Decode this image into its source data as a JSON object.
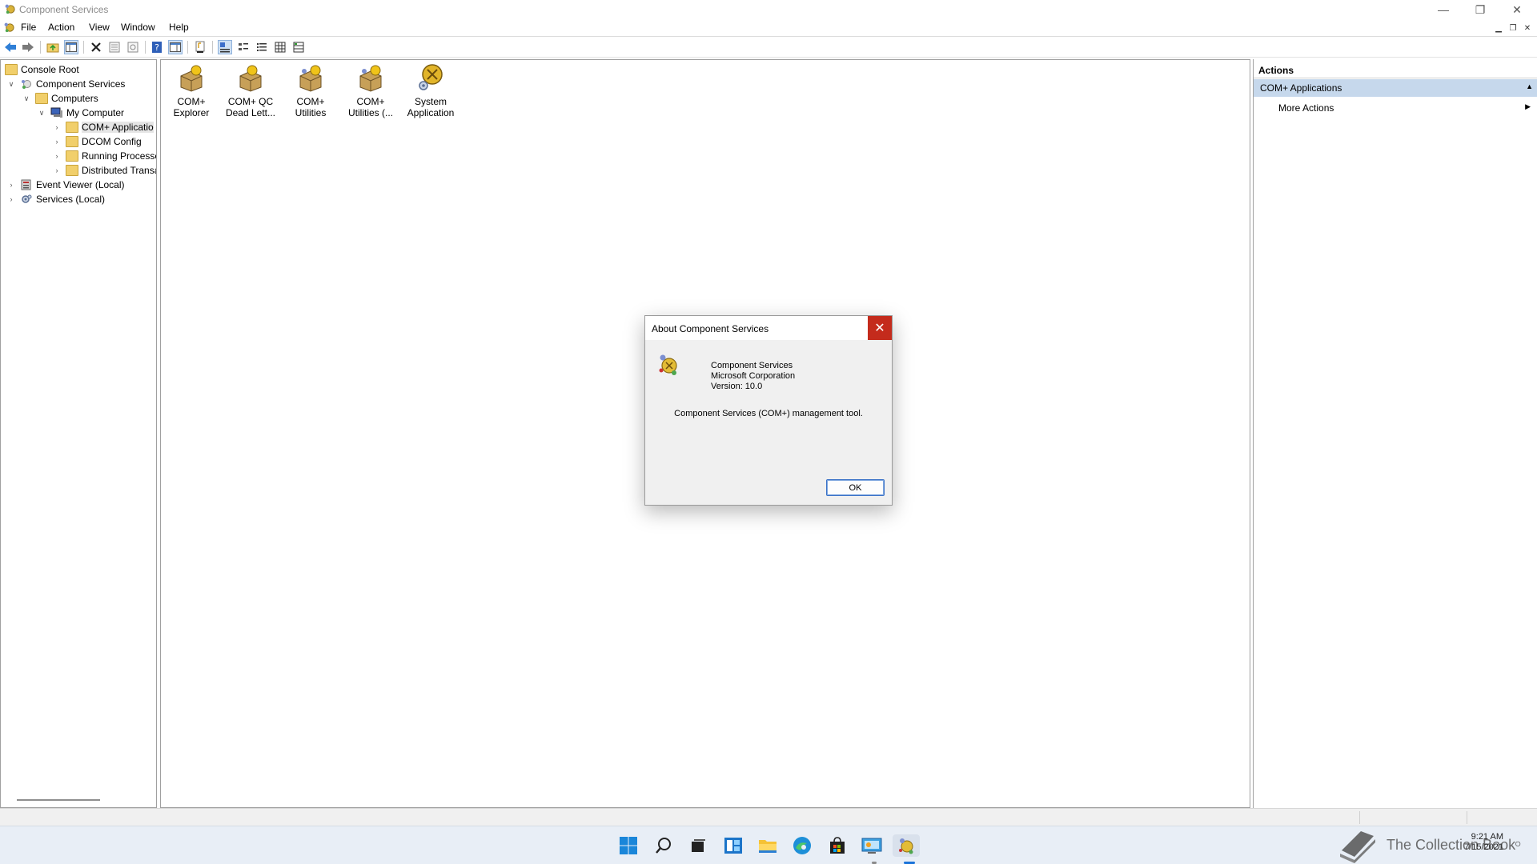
{
  "window": {
    "title": "Component Services",
    "controls": [
      "minimize",
      "restore",
      "close"
    ]
  },
  "menu": {
    "items": [
      "File",
      "Action",
      "View",
      "Window",
      "Help"
    ]
  },
  "toolbar": {
    "buttons": [
      "back-icon",
      "forward-icon",
      "up-folder-icon",
      "show-hide-tree-icon",
      "delete-icon",
      "properties-icon",
      "refresh-icon",
      "help-icon",
      "show-hide-action-pane-icon",
      "export-list-icon",
      "large-icons-view-icon",
      "small-icons-view-icon",
      "list-view-icon",
      "detail-view-icon",
      "status-view-icon"
    ]
  },
  "tree": {
    "items": [
      {
        "label": "Console Root",
        "level": 0,
        "expand": "none"
      },
      {
        "label": "Component Services",
        "level": 1,
        "expand": "expanded"
      },
      {
        "label": "Computers",
        "level": 2,
        "expand": "expanded"
      },
      {
        "label": "My Computer",
        "level": 3,
        "expand": "expanded"
      },
      {
        "label": "COM+ Applicatio",
        "level": 4,
        "expand": "collapsed",
        "selected": true
      },
      {
        "label": "DCOM Config",
        "level": 4,
        "expand": "collapsed"
      },
      {
        "label": "Running Processe",
        "level": 4,
        "expand": "collapsed"
      },
      {
        "label": "Distributed Transa",
        "level": 4,
        "expand": "collapsed"
      },
      {
        "label": "Event Viewer (Local)",
        "level": 1,
        "expand": "collapsed"
      },
      {
        "label": "Services (Local)",
        "level": 1,
        "expand": "collapsed"
      }
    ]
  },
  "applications": [
    {
      "line1": "COM+",
      "line2": "Explorer"
    },
    {
      "line1": "COM+ QC",
      "line2": "Dead Lett..."
    },
    {
      "line1": "COM+",
      "line2": "Utilities"
    },
    {
      "line1": "COM+",
      "line2": "Utilities (..."
    },
    {
      "line1": "System",
      "line2": "Application"
    }
  ],
  "actions": {
    "header": "Actions",
    "section": "COM+ Applications",
    "more": "More Actions"
  },
  "dialog": {
    "title": "About Component Services",
    "product": "Component Services",
    "company": "Microsoft Corporation",
    "version": "Version: 10.0",
    "description": "Component Services (COM+) management tool.",
    "ok_label": "OK"
  },
  "taskbar": {
    "apps": [
      "start-icon",
      "search-icon",
      "task-view-icon",
      "widgets-icon",
      "file-explorer-icon",
      "edge-icon",
      "store-icon",
      "control-panel-icon",
      "component-services-icon"
    ],
    "time": "9:21 AM",
    "date": "7/15/2021",
    "watermark": "The Collection Book"
  },
  "colors": {
    "selection": "#c6d8ec",
    "close_red": "#c42b1c",
    "folder": "#f1cf6b",
    "accent": "#1a73d9"
  }
}
